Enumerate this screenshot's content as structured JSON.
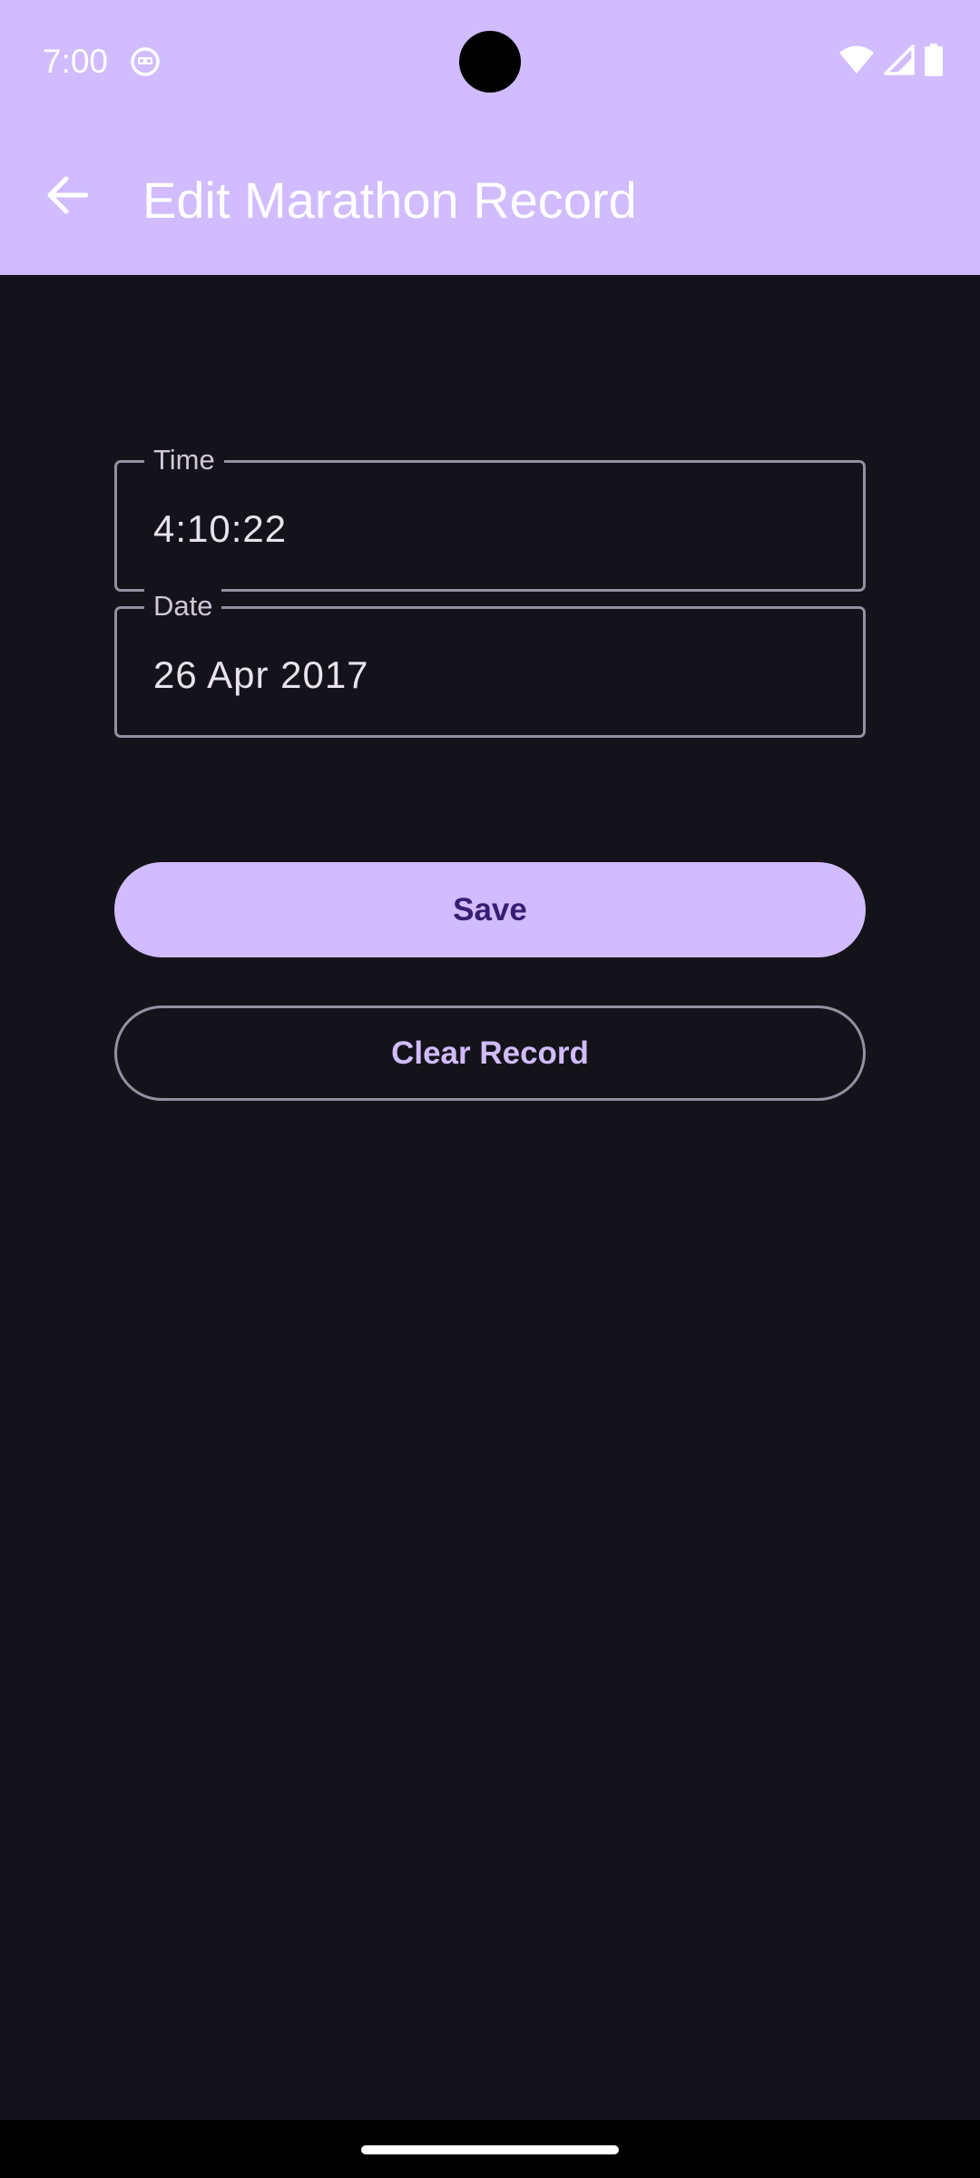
{
  "status_bar": {
    "time": "7:00",
    "icons": [
      "notification-icon",
      "wifi-icon",
      "cellular-signal-icon",
      "battery-icon"
    ]
  },
  "app_bar": {
    "back_icon": "arrow-back-icon",
    "title": "Edit Marathon Record"
  },
  "form": {
    "time_field": {
      "label": "Time",
      "value": "4:10:22"
    },
    "date_field": {
      "label": "Date",
      "value": "26 Apr 2017"
    }
  },
  "actions": {
    "save_label": "Save",
    "clear_label": "Clear Record"
  },
  "colors": {
    "primary": "#d0bcfe",
    "on_primary": "#381e72",
    "background": "#15131a",
    "outline": "#958fa0"
  }
}
